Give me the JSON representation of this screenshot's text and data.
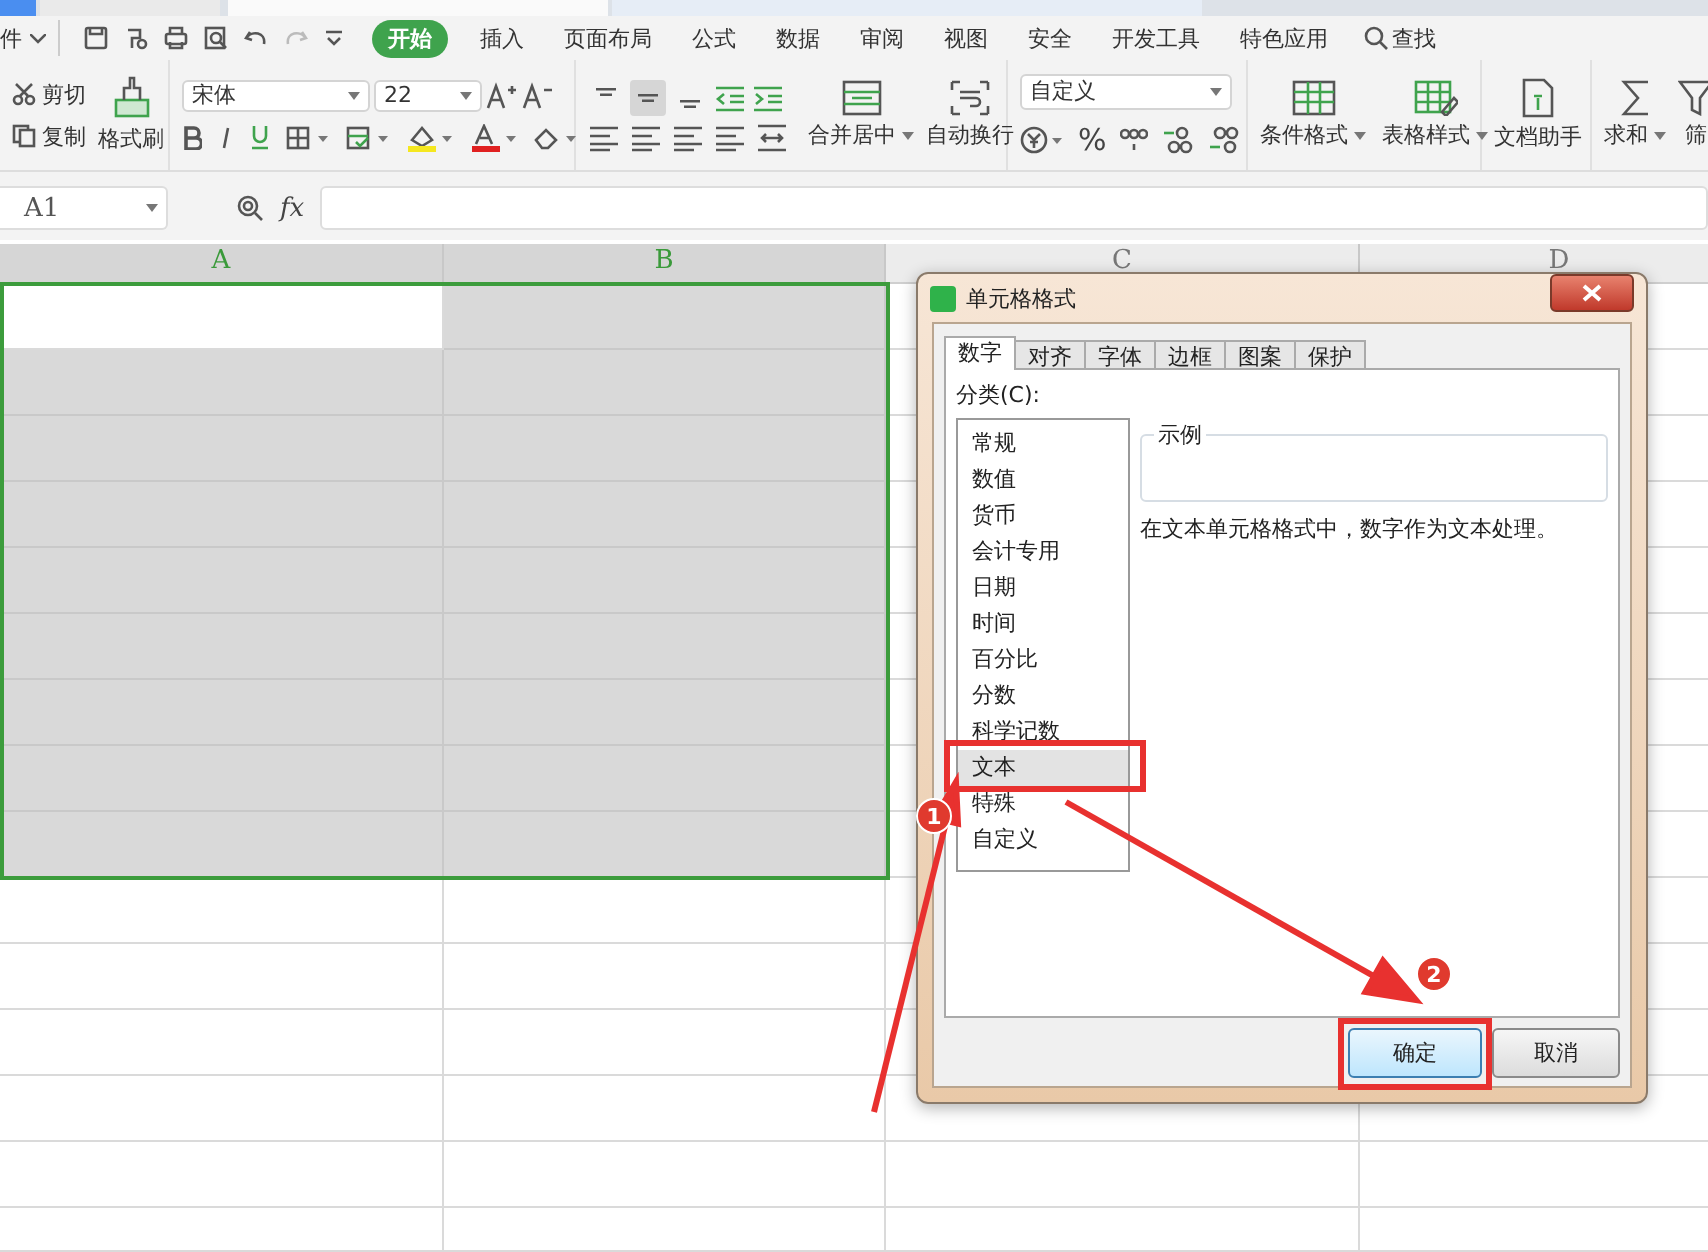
{
  "menu": {
    "file_label": "件",
    "tabs": [
      {
        "label": "开始",
        "selected": true
      },
      {
        "label": "插入",
        "selected": false
      },
      {
        "label": "页面布局",
        "selected": false
      },
      {
        "label": "公式",
        "selected": false
      },
      {
        "label": "数据",
        "selected": false
      },
      {
        "label": "审阅",
        "selected": false
      },
      {
        "label": "视图",
        "selected": false
      },
      {
        "label": "安全",
        "selected": false
      },
      {
        "label": "开发工具",
        "selected": false
      },
      {
        "label": "特色应用",
        "selected": false
      }
    ],
    "search_label": "查找"
  },
  "ribbon": {
    "cut": "剪切",
    "copy": "复制",
    "format_painter": "格式刷",
    "font_name": "宋体",
    "font_size": "22",
    "vertical_align": [
      {
        "kind": "top",
        "selected": false
      },
      {
        "kind": "middle",
        "selected": true
      },
      {
        "kind": "bottom",
        "selected": false
      }
    ],
    "merge": "合并居中",
    "wrap": "自动换行",
    "number_format": "自定义",
    "percent": "%",
    "conditional_format": "条件格式",
    "table_style": "表格样式",
    "doc_assistant": "文档助手",
    "sum": "求和",
    "filter": "筛"
  },
  "formula_bar": {
    "name_box": "A1",
    "fx": "fx"
  },
  "sheet": {
    "columns": [
      {
        "label": "A",
        "selected": true
      },
      {
        "label": "B",
        "selected": true
      },
      {
        "label": "C",
        "selected": false
      },
      {
        "label": "D",
        "selected": false
      }
    ],
    "rows": [
      {
        "selected": true
      },
      {
        "selected": true
      },
      {
        "selected": true
      },
      {
        "selected": true
      },
      {
        "selected": true
      },
      {
        "selected": true
      },
      {
        "selected": true
      },
      {
        "selected": true
      },
      {
        "selected": true
      },
      {
        "selected": false
      },
      {
        "selected": false
      },
      {
        "selected": false
      },
      {
        "selected": false
      },
      {
        "selected": false
      },
      {
        "selected": false
      }
    ]
  },
  "dialog": {
    "title": "单元格格式",
    "tabs": [
      {
        "label": "数字",
        "selected": true
      },
      {
        "label": "对齐",
        "selected": false
      },
      {
        "label": "字体",
        "selected": false
      },
      {
        "label": "边框",
        "selected": false
      },
      {
        "label": "图案",
        "selected": false
      },
      {
        "label": "保护",
        "selected": false
      }
    ],
    "category_label": "分类(C):",
    "categories": [
      {
        "label": "常规",
        "selected": false,
        "highlighted": false
      },
      {
        "label": "数值",
        "selected": false,
        "highlighted": false
      },
      {
        "label": "货币",
        "selected": false,
        "highlighted": false
      },
      {
        "label": "会计专用",
        "selected": false,
        "highlighted": false
      },
      {
        "label": "日期",
        "selected": false,
        "highlighted": false
      },
      {
        "label": "时间",
        "selected": false,
        "highlighted": false
      },
      {
        "label": "百分比",
        "selected": false,
        "highlighted": false
      },
      {
        "label": "分数",
        "selected": false,
        "highlighted": false
      },
      {
        "label": "科学记数",
        "selected": false,
        "highlighted": false
      },
      {
        "label": "文本",
        "selected": true,
        "highlighted": true
      },
      {
        "label": "特殊",
        "selected": false,
        "highlighted": false
      },
      {
        "label": "自定义",
        "selected": false,
        "highlighted": false
      }
    ],
    "sample_label": "示例",
    "description": "在文本单元格格式中，数字作为文本处理。",
    "buttons": [
      {
        "label": "确定",
        "default": true,
        "highlighted": true
      },
      {
        "label": "取消",
        "default": false,
        "highlighted": false
      }
    ]
  },
  "annotations": [
    {
      "number": "1"
    },
    {
      "number": "2"
    }
  ]
}
